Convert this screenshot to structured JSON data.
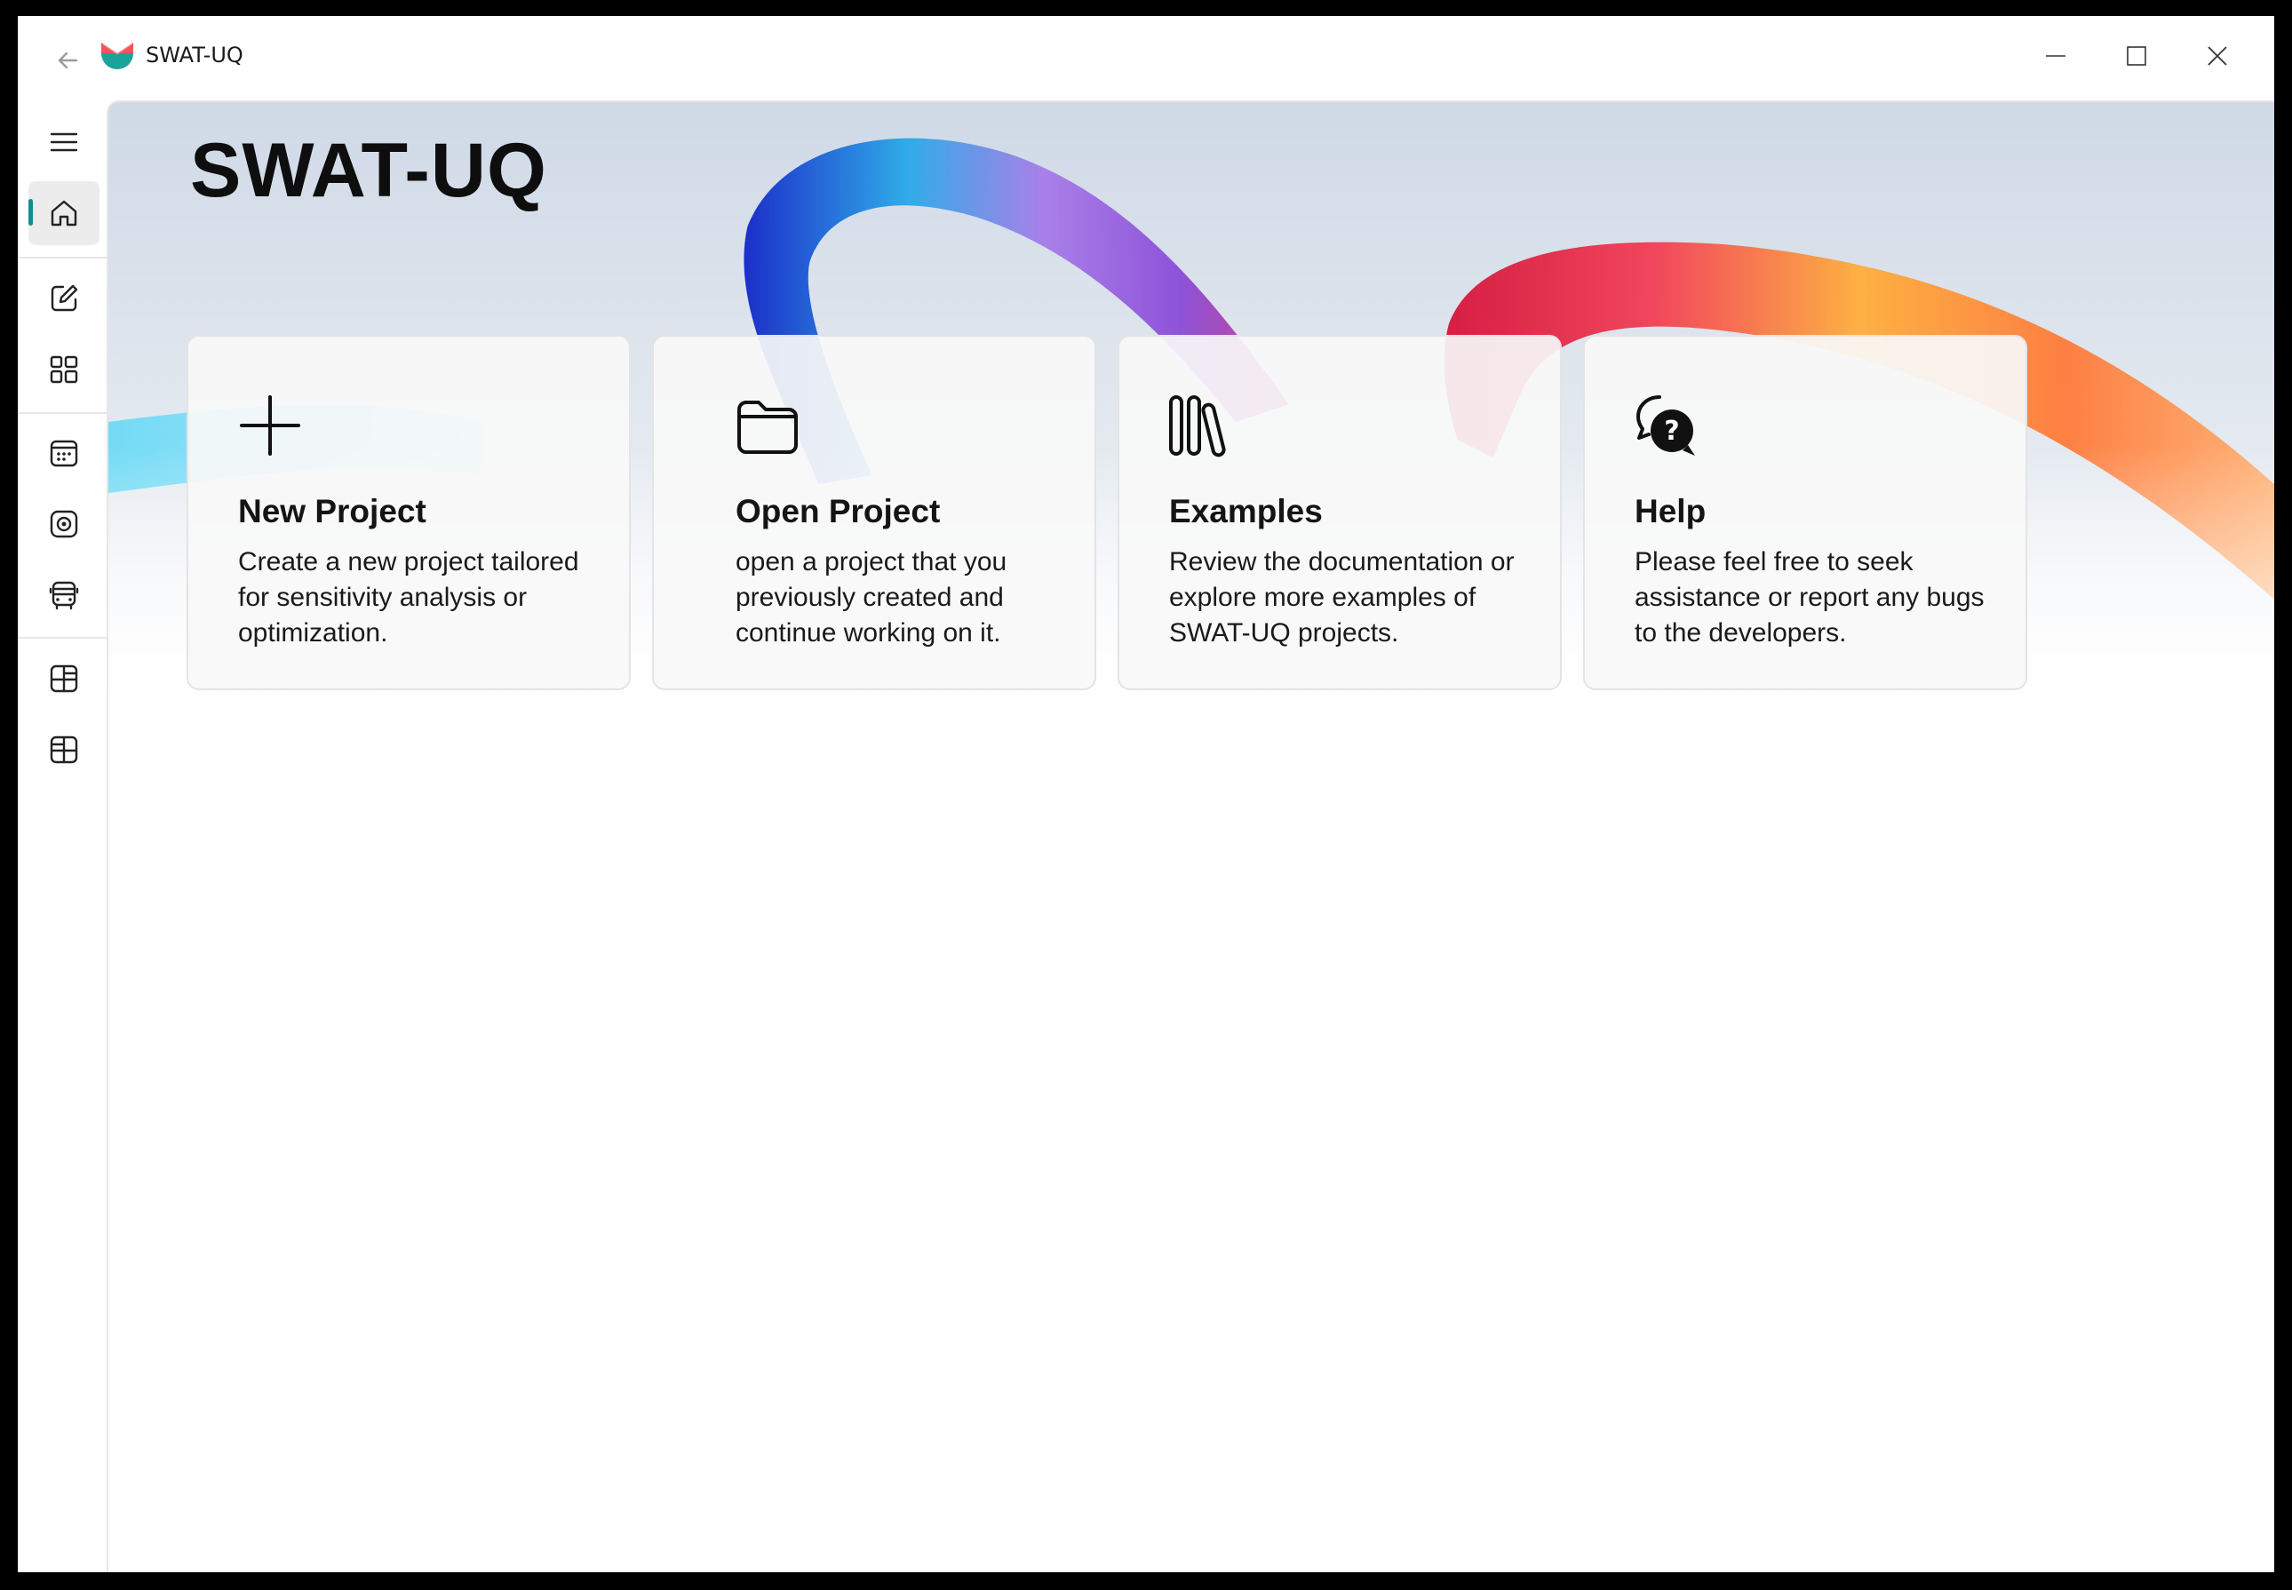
{
  "window": {
    "title": "SWAT-UQ"
  },
  "sidebar": {
    "items": [
      {
        "name": "menu",
        "icon": "hamburger-icon"
      },
      {
        "name": "home",
        "icon": "home-icon",
        "active": true
      },
      {
        "name": "edit",
        "icon": "edit-icon"
      },
      {
        "name": "apps",
        "icon": "apps-icon"
      },
      {
        "name": "calendar",
        "icon": "calendar-icon"
      },
      {
        "name": "target",
        "icon": "target-icon"
      },
      {
        "name": "bus",
        "icon": "bus-icon"
      },
      {
        "name": "layout-a",
        "icon": "layout-icon"
      },
      {
        "name": "layout-b",
        "icon": "layout-icon"
      }
    ]
  },
  "main": {
    "title": "SWAT-UQ",
    "cards": [
      {
        "title": "New Project",
        "description": "Create a new project tailored for sensitivity analysis or optimization.",
        "icon": "plus-icon"
      },
      {
        "title": "Open Project",
        "description": "open a project that you previously created and continue working on it.",
        "icon": "folder-icon"
      },
      {
        "title": "Examples",
        "description": "Review the documentation or explore more examples of SWAT-UQ projects.",
        "icon": "library-icon"
      },
      {
        "title": "Help",
        "description": "Please feel free to seek assistance or report any bugs to the developers.",
        "icon": "chat-help-icon"
      }
    ]
  },
  "colors": {
    "accent": "#0f8f8f",
    "logo_red": "#f2545b",
    "logo_teal": "#1aa39a"
  }
}
